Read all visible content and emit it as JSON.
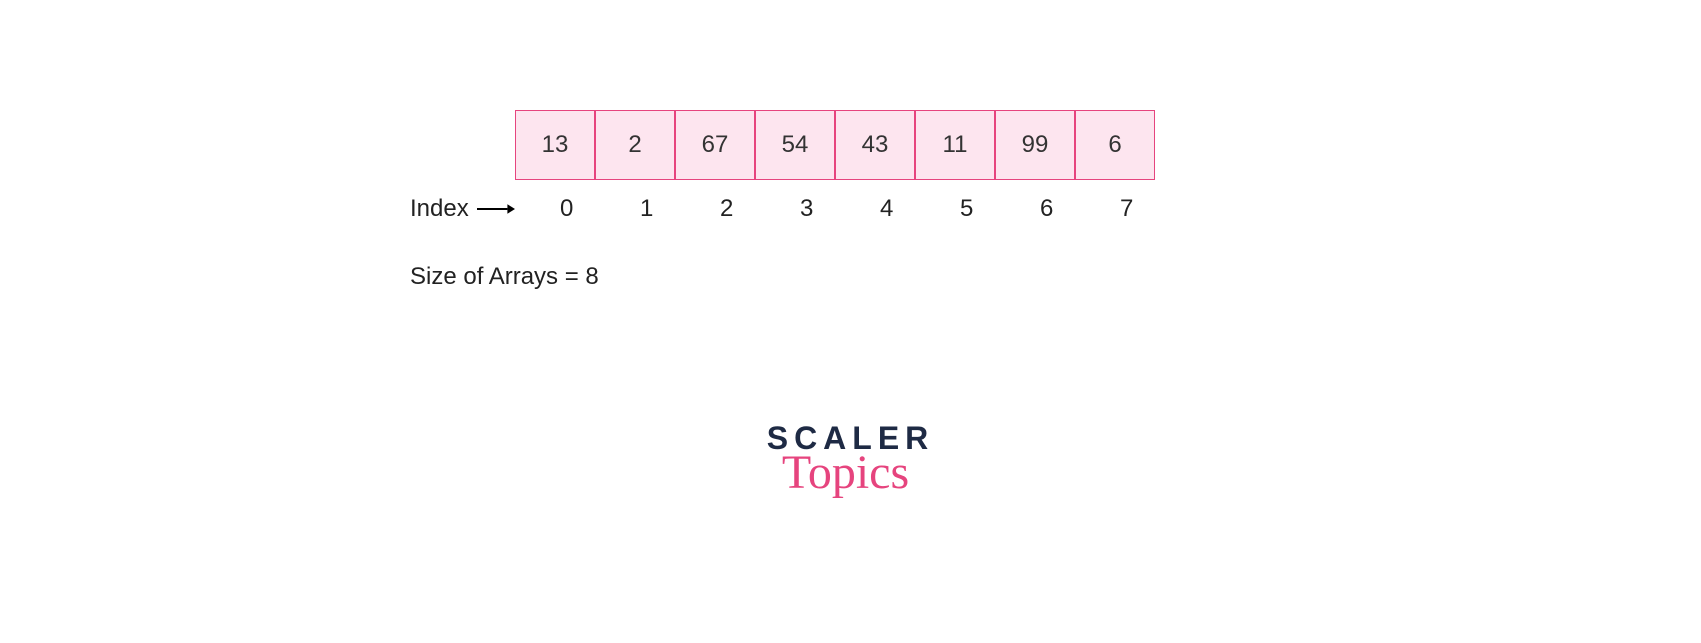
{
  "array": {
    "values": [
      "13",
      "2",
      "67",
      "54",
      "43",
      "11",
      "99",
      "6"
    ],
    "indices": [
      "0",
      "1",
      "2",
      "3",
      "4",
      "5",
      "6",
      "7"
    ]
  },
  "labels": {
    "index": "Index",
    "size": "Size of Arrays = 8"
  },
  "logo": {
    "line1": "SCALER",
    "line2": "Topics"
  }
}
